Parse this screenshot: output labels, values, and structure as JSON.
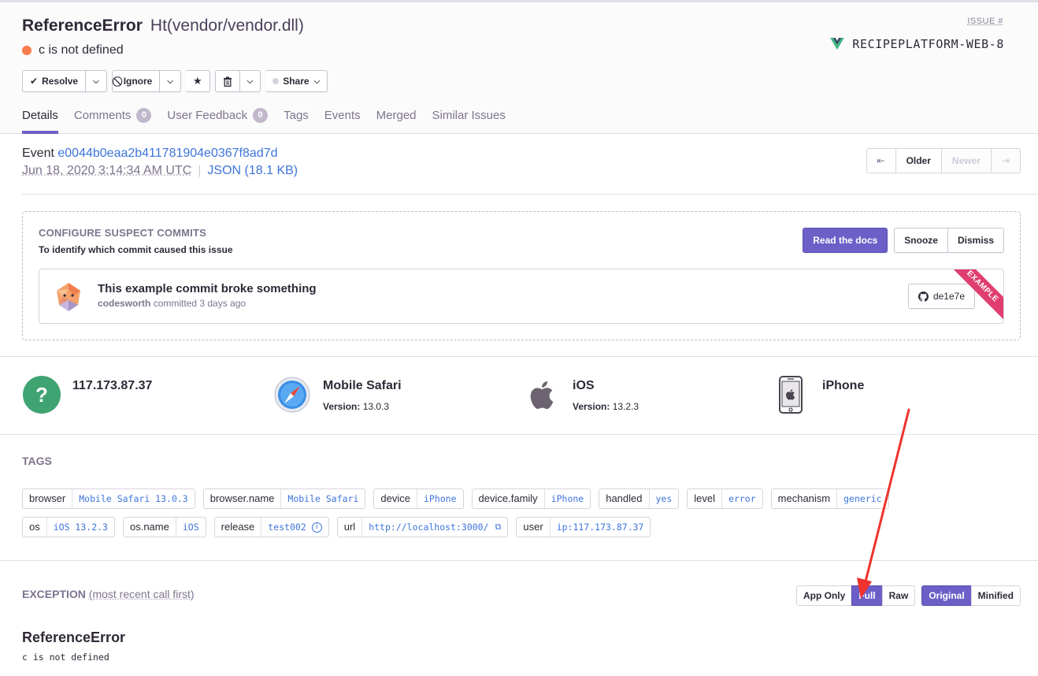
{
  "header": {
    "error_type": "ReferenceError",
    "error_location": "Ht(vendor/vendor.dll)",
    "message": "c is not defined",
    "issue_label": "ISSUE #",
    "project_short_id": "RECIPEPLATFORM-WEB-8"
  },
  "actions": {
    "resolve": "Resolve",
    "ignore": "Ignore",
    "share": "Share"
  },
  "tabs": [
    {
      "label": "Details"
    },
    {
      "label": "Comments",
      "count": "0"
    },
    {
      "label": "User Feedback",
      "count": "0"
    },
    {
      "label": "Tags"
    },
    {
      "label": "Events"
    },
    {
      "label": "Merged"
    },
    {
      "label": "Similar Issues"
    }
  ],
  "event": {
    "label": "Event",
    "id": "e0044b0eaa2b411781904e0367f8ad7d",
    "date": "Jun 18, 2020 3:14:34 AM UTC",
    "json_link": "JSON (18.1 KB)",
    "pager": {
      "first": "⇤",
      "older": "Older",
      "newer": "Newer",
      "last": "⇥"
    }
  },
  "suspect_commits": {
    "title": "CONFIGURE SUSPECT COMMITS",
    "subtitle": "To identify which commit caused this issue",
    "read_docs": "Read the docs",
    "snooze": "Snooze",
    "dismiss": "Dismiss",
    "commit_message": "This example commit broke something",
    "author": "codesworth",
    "committed_text": "committed 3 days ago",
    "sha": "de1e7e",
    "ribbon": "EXAMPLE"
  },
  "context": {
    "user": {
      "name": "117.173.87.37"
    },
    "browser": {
      "name": "Mobile Safari",
      "version_label": "Version:",
      "version": "13.0.3"
    },
    "os": {
      "name": "iOS",
      "version_label": "Version:",
      "version": "13.2.3"
    },
    "device": {
      "name": "iPhone"
    }
  },
  "tags": {
    "title": "TAGS",
    "rows": [
      [
        {
          "key": "browser",
          "value": "Mobile Safari 13.0.3"
        },
        {
          "key": "browser.name",
          "value": "Mobile Safari"
        },
        {
          "key": "device",
          "value": "iPhone"
        },
        {
          "key": "device.family",
          "value": "iPhone"
        },
        {
          "key": "handled",
          "value": "yes"
        },
        {
          "key": "level",
          "value": "error"
        },
        {
          "key": "mechanism",
          "value": "generic"
        }
      ],
      [
        {
          "key": "os",
          "value": "iOS 13.2.3"
        },
        {
          "key": "os.name",
          "value": "iOS"
        },
        {
          "key": "release",
          "value": "test002"
        },
        {
          "key": "url",
          "value": "http://localhost:3000/"
        },
        {
          "key": "user",
          "value": "ip:117.173.87.37"
        }
      ]
    ]
  },
  "exception": {
    "title": "EXCEPTION",
    "subtitle": "(most recent call first)",
    "buttons": {
      "app_only": "App Only",
      "full": "Full",
      "raw": "Raw",
      "original": "Original",
      "minified": "Minified"
    },
    "type": "ReferenceError",
    "value": "c is not defined"
  },
  "colors": {
    "accent": "#6c5fc7",
    "link": "#3d74db",
    "error_dot": "#fa7b4b",
    "example_ribbon": "#e03e6f",
    "annotation_arrow": "#f0332e"
  },
  "icons": [
    "check-icon",
    "chevron-down-icon",
    "ignore-icon",
    "star-icon",
    "trash-icon",
    "vue-logo-icon",
    "github-icon",
    "question-icon",
    "safari-icon",
    "apple-icon",
    "iphone-icon",
    "info-icon",
    "external-link-icon"
  ]
}
